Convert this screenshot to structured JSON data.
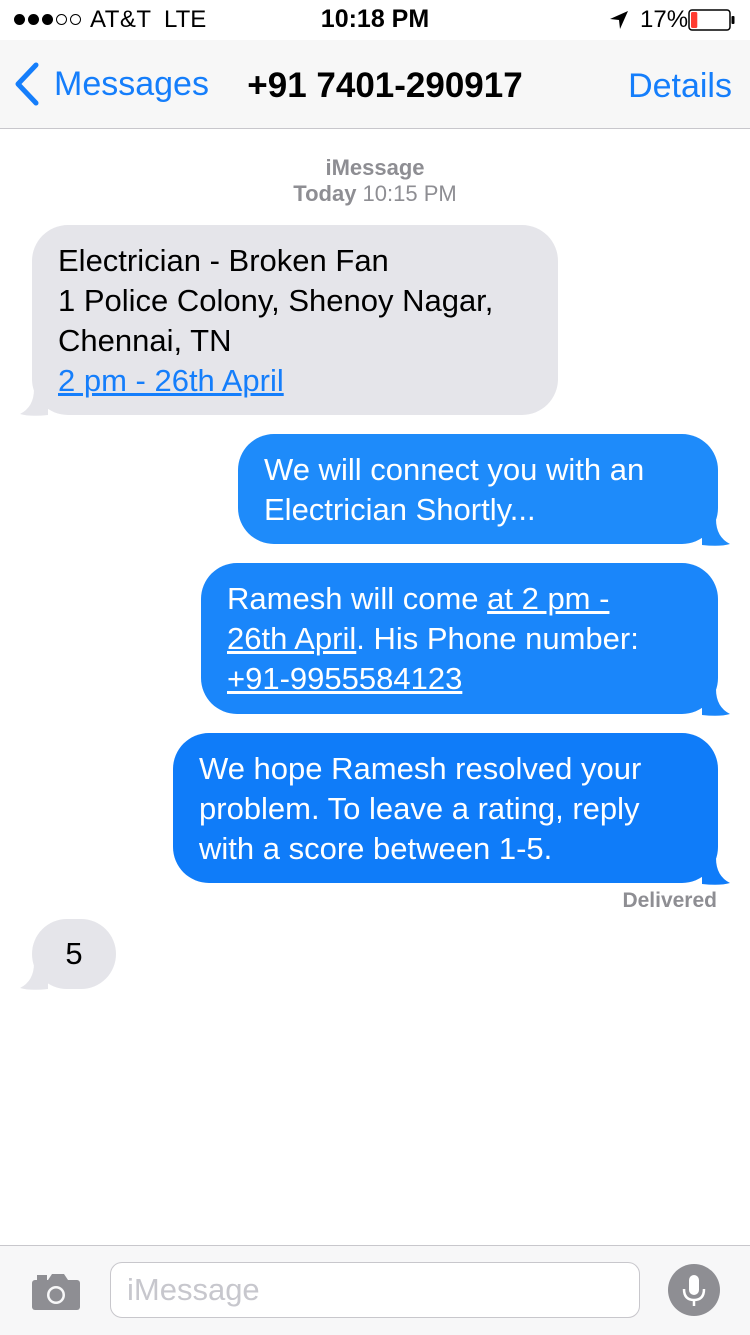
{
  "status_bar": {
    "carrier": "AT&T",
    "network": "LTE",
    "time": "10:18 PM",
    "battery_percent": "17%",
    "signal_bars_filled": 3,
    "signal_bars_total": 5,
    "battery_level": 0.17,
    "battery_color": "#ff3b30"
  },
  "nav": {
    "back_label": "Messages",
    "title": "+91 7401-290917",
    "details_label": "Details",
    "accent_color": "#157efb"
  },
  "conversation": {
    "service": "iMessage",
    "timestamp_day": "Today",
    "timestamp_time": " 10:15 PM",
    "messages": [
      {
        "direction": "incoming",
        "lines": [
          "Electrician - Broken Fan",
          "1 Police Colony, Shenoy Nagar,",
          "Chennai, TN"
        ],
        "link": "2 pm - 26th April"
      },
      {
        "direction": "outgoing",
        "lines": [
          "We will connect you with an",
          "Electrician Shortly..."
        ]
      },
      {
        "direction": "outgoing",
        "line1_prefix": "Ramesh will come ",
        "line1_link": "at 2 pm -",
        "line2_link": "26th April",
        "line2_suffix": ". His Phone number:",
        "line3_link": "+91-9955584123"
      },
      {
        "direction": "outgoing",
        "lines": [
          "We hope Ramesh resolved your",
          "problem. To leave a rating, reply",
          "with a score between 1-5."
        ]
      },
      {
        "direction": "incoming",
        "text": "5"
      }
    ],
    "delivery_status": "Delivered",
    "incoming_color": "#e5e5ea",
    "outgoing_color": "#1e8bfa"
  },
  "input_bar": {
    "placeholder": "iMessage"
  }
}
